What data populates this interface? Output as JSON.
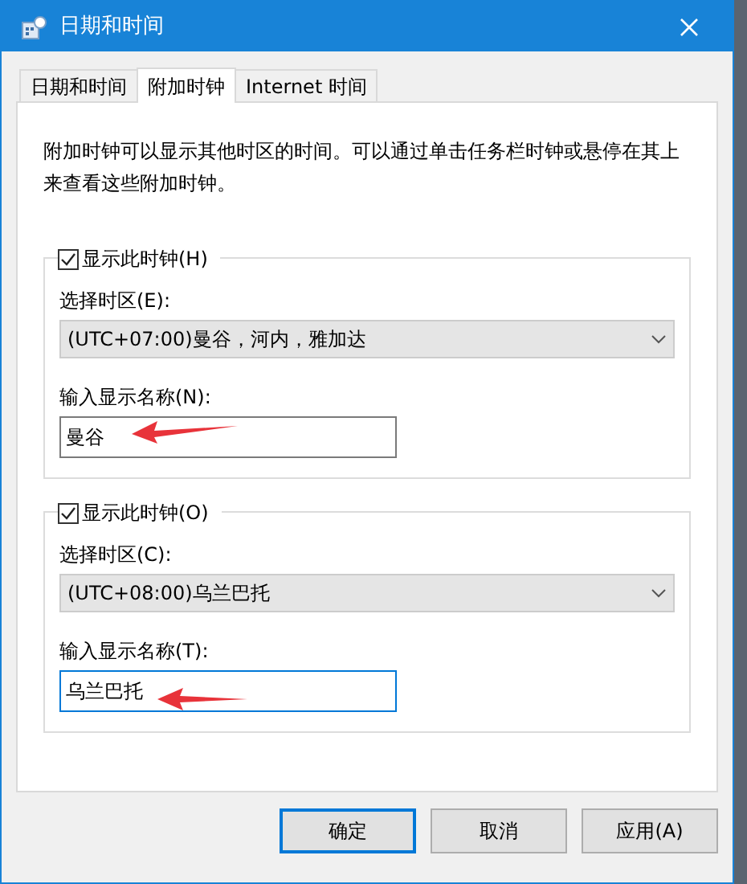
{
  "window": {
    "title": "日期和时间"
  },
  "tabs": [
    {
      "label": "日期和时间",
      "selected": false
    },
    {
      "label": "附加时钟",
      "selected": true
    },
    {
      "label": "Internet 时间",
      "selected": false
    }
  ],
  "description": "附加时钟可以显示其他时区的时间。可以通过单击任务栏时钟或悬停在其上来查看这些附加时钟。",
  "clocks": [
    {
      "show_label": "显示此时钟(H)",
      "checked": true,
      "timezone_label": "选择时区(E):",
      "timezone": "(UTC+07:00)曼谷，河内，雅加达",
      "name_label": "输入显示名称(N):",
      "name_value": "曼谷",
      "focused": false
    },
    {
      "show_label": "显示此时钟(O)",
      "checked": true,
      "timezone_label": "选择时区(C):",
      "timezone": "(UTC+08:00)乌兰巴托",
      "name_label": "输入显示名称(T):",
      "name_value": "乌兰巴托",
      "focused": true
    }
  ],
  "buttons": [
    {
      "label": "确定",
      "selected": true
    },
    {
      "label": "取消",
      "selected": false
    },
    {
      "label": "应用(A)",
      "selected": false
    }
  ]
}
